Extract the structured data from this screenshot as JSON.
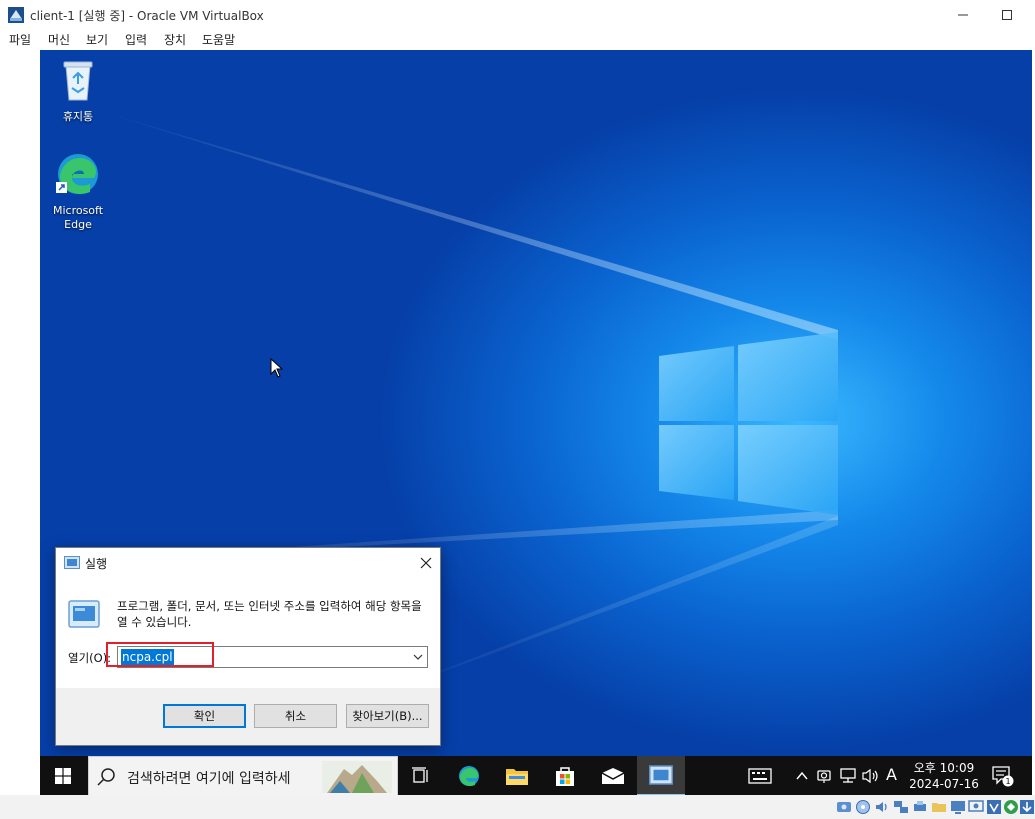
{
  "window": {
    "title": "client-1 [실행 중] - Oracle VM VirtualBox",
    "menu": [
      "파일",
      "머신",
      "보기",
      "입력",
      "장치",
      "도움말"
    ]
  },
  "desktop": {
    "icons": [
      {
        "name": "recycle-bin",
        "label": "휴지통"
      },
      {
        "name": "microsoft-edge",
        "label": "Microsoft\nEdge",
        "label_line1": "Microsoft",
        "label_line2": "Edge"
      }
    ]
  },
  "run_dialog": {
    "title": "실행",
    "description": "프로그램, 폴더, 문서, 또는 인터넷 주소를 입력하여 해당 항목을 열 수 있습니다.",
    "open_label": "열기(O):",
    "input_value": "ncpa.cpl",
    "buttons": {
      "ok": "확인",
      "cancel": "취소",
      "browse": "찾아보기(B)..."
    }
  },
  "taskbar": {
    "search_placeholder": "검색하려면 여기에 입력하세",
    "tray": {
      "ime": "A",
      "time": "오후 10:09",
      "date": "2024-07-16",
      "notification_count": "1"
    }
  },
  "colors": {
    "accent": "#0078d7",
    "highlight_box": "#e0202a",
    "taskbar": "#101010",
    "desktop": "#1488ea"
  }
}
